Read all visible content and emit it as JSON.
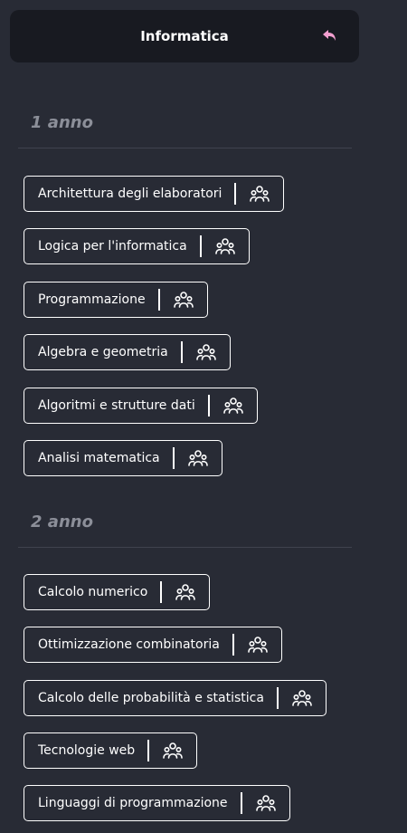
{
  "header": {
    "title": "Informatica",
    "back_icon": "back-arrow-icon",
    "back_icon_color": "#f29fd0"
  },
  "colors": {
    "background": "#282b35",
    "header_background": "#181a21",
    "section_title": "#8c8f99",
    "divider": "#3f434e",
    "course_border": "#ffffff"
  },
  "sections": [
    {
      "title": "1 anno",
      "courses": [
        {
          "name": "Architettura degli elaboratori",
          "icon": "group-icon"
        },
        {
          "name": "Logica per l'informatica",
          "icon": "group-icon"
        },
        {
          "name": "Programmazione",
          "icon": "group-icon"
        },
        {
          "name": "Algebra e geometria",
          "icon": "group-icon"
        },
        {
          "name": "Algoritmi e strutture dati",
          "icon": "group-icon"
        },
        {
          "name": "Analisi matematica",
          "icon": "group-icon"
        }
      ]
    },
    {
      "title": "2 anno",
      "courses": [
        {
          "name": "Calcolo numerico",
          "icon": "group-icon"
        },
        {
          "name": "Ottimizzazione combinatoria",
          "icon": "group-icon"
        },
        {
          "name": "Calcolo delle probabilità e statistica",
          "icon": "group-icon"
        },
        {
          "name": "Tecnologie web",
          "icon": "group-icon"
        },
        {
          "name": "Linguaggi di programmazione",
          "icon": "group-icon"
        }
      ]
    }
  ]
}
